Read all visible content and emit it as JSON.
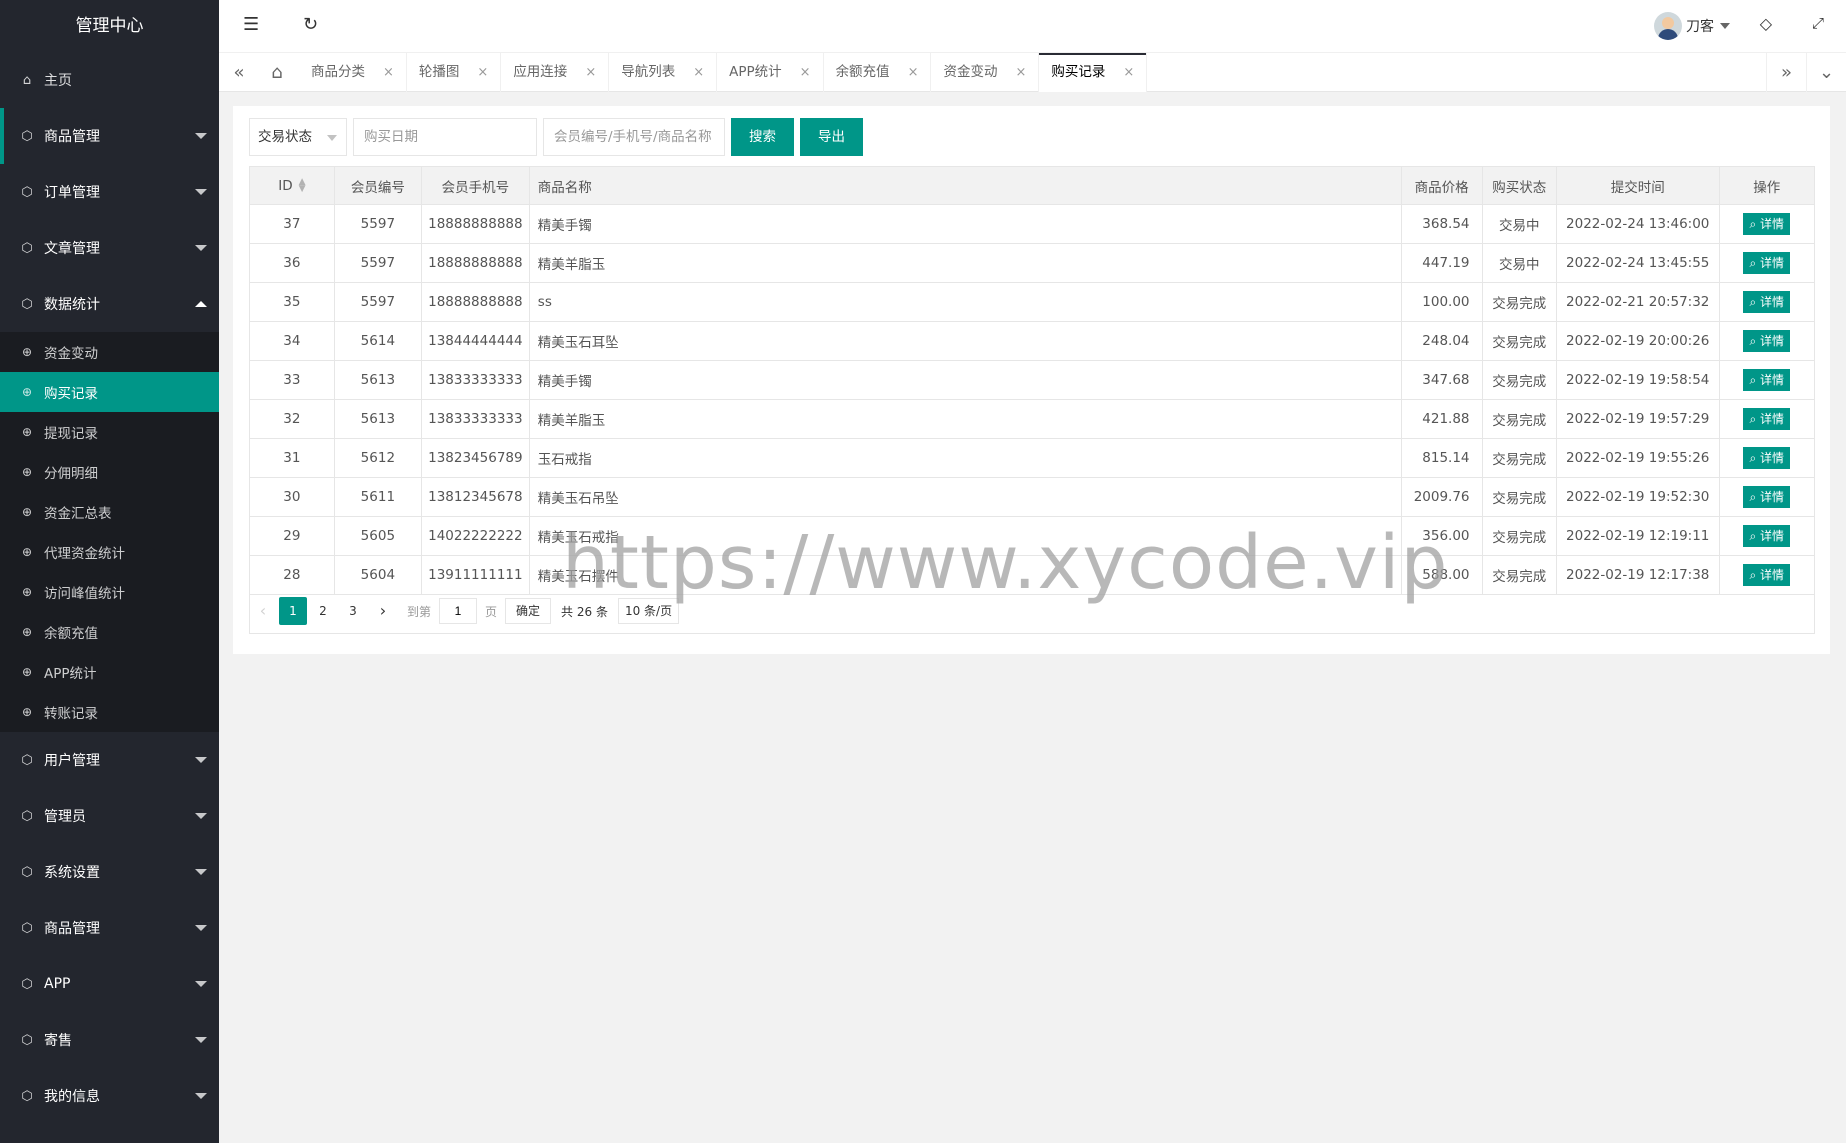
{
  "sidebar": {
    "logo": "管理中心",
    "home": "主页",
    "groups_before": [
      {
        "label": "商品管理",
        "active_bar": true
      },
      {
        "label": "订单管理"
      },
      {
        "label": "文章管理"
      }
    ],
    "open_group": "数据统计",
    "sub_items": [
      "资金变动",
      "购买记录",
      "提现记录",
      "分佣明细",
      "资金汇总表",
      "代理资金统计",
      "访问峰值统计",
      "余额充值",
      "APP统计",
      "转账记录"
    ],
    "active_sub": "购买记录",
    "groups_after": [
      "用户管理",
      "管理员",
      "系统设置",
      "商品管理",
      "APP",
      "寄售",
      "我的信息"
    ]
  },
  "header": {
    "menu_icon": "menu-fold-icon",
    "refresh_icon": "refresh-icon",
    "username": "刀客",
    "tag_icon": "tag-icon",
    "fullscreen_icon": "fullscreen-icon"
  },
  "tabs": {
    "items": [
      "商品分类",
      "轮播图",
      "应用连接",
      "导航列表",
      "APP统计",
      "余额充值",
      "资金变动",
      "购买记录"
    ],
    "active": "购买记录"
  },
  "toolbar": {
    "status_select": "交易状态",
    "date_placeholder": "购买日期",
    "keyword_placeholder": "会员编号/手机号/商品名称",
    "search_label": "搜索",
    "export_label": "导出"
  },
  "table": {
    "headers": [
      "ID",
      "会员编号",
      "会员手机号",
      "商品名称",
      "商品价格",
      "购买状态",
      "提交时间",
      "操作"
    ],
    "detail_label": "详情",
    "rows": [
      [
        "37",
        "5597",
        "18888888888",
        "精美手镯",
        "368.54",
        "交易中",
        "2022-02-24 13:46:00"
      ],
      [
        "36",
        "5597",
        "18888888888",
        "精美羊脂玉",
        "447.19",
        "交易中",
        "2022-02-24 13:45:55"
      ],
      [
        "35",
        "5597",
        "18888888888",
        "ss",
        "100.00",
        "交易完成",
        "2022-02-21 20:57:32"
      ],
      [
        "34",
        "5614",
        "13844444444",
        "精美玉石耳坠",
        "248.04",
        "交易完成",
        "2022-02-19 20:00:26"
      ],
      [
        "33",
        "5613",
        "13833333333",
        "精美手镯",
        "347.68",
        "交易完成",
        "2022-02-19 19:58:54"
      ],
      [
        "32",
        "5613",
        "13833333333",
        "精美羊脂玉",
        "421.88",
        "交易完成",
        "2022-02-19 19:57:29"
      ],
      [
        "31",
        "5612",
        "13823456789",
        "玉石戒指",
        "815.14",
        "交易完成",
        "2022-02-19 19:55:26"
      ],
      [
        "30",
        "5611",
        "13812345678",
        "精美玉石吊坠",
        "2009.76",
        "交易完成",
        "2022-02-19 19:52:30"
      ],
      [
        "29",
        "5605",
        "14022222222",
        "精美玉石戒指",
        "356.00",
        "交易完成",
        "2022-02-19 12:19:11"
      ],
      [
        "28",
        "5604",
        "13911111111",
        "精美玉石摆件",
        "588.00",
        "交易完成",
        "2022-02-19 12:17:38"
      ]
    ]
  },
  "pager": {
    "pages": [
      "1",
      "2",
      "3"
    ],
    "current": "1",
    "goto_label": "到第",
    "goto_value": "1",
    "page_unit": "页",
    "confirm_label": "确定",
    "total_label": "共 26 条",
    "limit_label": "10 条/页"
  },
  "watermark": "https://www.xycode.vip",
  "colors": {
    "accent": "#009688",
    "sidebar_bg": "#23262e",
    "sub_bg": "#1a1c21"
  }
}
